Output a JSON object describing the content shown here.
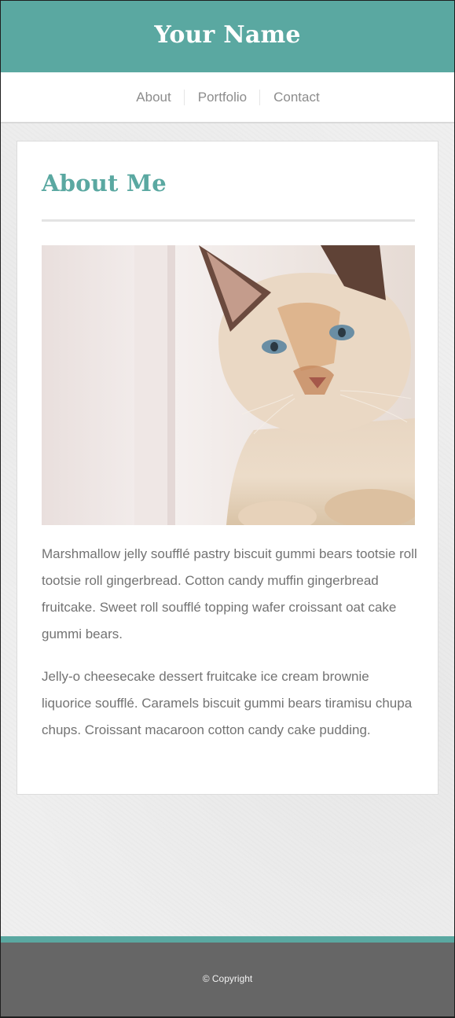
{
  "header": {
    "site_title": "Your Name"
  },
  "nav": {
    "items": [
      {
        "label": "About"
      },
      {
        "label": "Portfolio"
      },
      {
        "label": "Contact"
      }
    ]
  },
  "main": {
    "heading": "About Me",
    "image": {
      "alt": "cat photo",
      "subject": "cream and ginger cat"
    },
    "paragraphs": [
      "Marshmallow jelly soufflé pastry biscuit gummi bears tootsie roll tootsie roll gingerbread. Cotton candy muffin gingerbread fruitcake. Sweet roll soufflé topping wafer croissant oat cake gummi bears.",
      "Jelly-o cheesecake dessert fruitcake ice cream brownie liquorice soufflé. Caramels biscuit gummi bears tiramisu chupa chups. Croissant macaroon cotton candy cake pudding."
    ]
  },
  "footer": {
    "copyright": "© Copyright"
  },
  "colors": {
    "accent": "#5aa8a1",
    "footer_bg": "#666666",
    "body_text": "#737373",
    "nav_text": "#8c8c8c"
  }
}
